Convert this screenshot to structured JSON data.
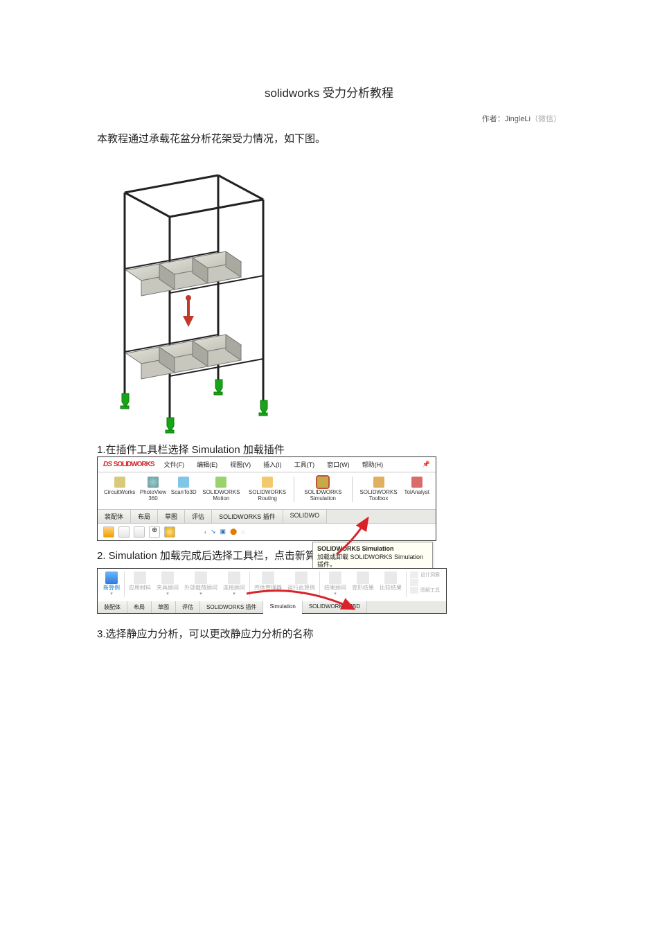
{
  "title": "solidworks 受力分析教程",
  "author_prefix": "作者：",
  "author_name": "JingleLi",
  "author_suffix": "（微信）",
  "intro": "本教程通过承载花盆分析花架受力情况，如下图。",
  "step1": "1.在插件工具栏选择 Simulation 加载插件",
  "step2": "2. Simulation 加载完成后选择工具栏，点击新算例",
  "step3": "3.选择静应力分析，可以更改静应力分析的名称",
  "shot1": {
    "logo": "SOLIDWORKS",
    "logo_prefix": "DS",
    "menu": [
      "文件(F)",
      "编辑(E)",
      "视图(V)",
      "插入(I)",
      "工具(T)",
      "窗口(W)",
      "帮助(H)"
    ],
    "addins": [
      {
        "label": "CircuitWorks"
      },
      {
        "label": "PhotoView 360"
      },
      {
        "label": "ScanTo3D"
      },
      {
        "label": "SOLIDWORKS Motion"
      },
      {
        "label": "SOLIDWORKS Routing"
      },
      {
        "label": "SOLIDWORKS Simulation"
      },
      {
        "label": "SOLIDWORKS Toolbox"
      },
      {
        "label": "TolAnalyst"
      }
    ],
    "tabs": [
      "装配体",
      "布局",
      "草图",
      "评估",
      "SOLIDWORKS 插件",
      "SOLIDWO"
    ],
    "tooltip_title": "SOLIDWORKS Simulation",
    "tooltip_body": "加载或卸载 SOLIDWORKS Simulation 插件。"
  },
  "shot2": {
    "buttons": [
      {
        "label": "新算例",
        "active": true
      },
      {
        "label": "应用材料"
      },
      {
        "label": "夹具顾问"
      },
      {
        "label": "外部载荷顾问"
      },
      {
        "label": "连接顾问"
      },
      {
        "label": "壳体管理器"
      },
      {
        "label": "运行此算例"
      },
      {
        "label": "结果顾问"
      },
      {
        "label": "变形结果"
      },
      {
        "label": "比较结果"
      }
    ],
    "stack": [
      "设计洞察",
      "",
      "图解工具"
    ],
    "tabs": [
      "装配体",
      "布局",
      "草图",
      "评估",
      "SOLIDWORKS 插件",
      "Simulation",
      "SOLIDWORKS MBD"
    ]
  }
}
